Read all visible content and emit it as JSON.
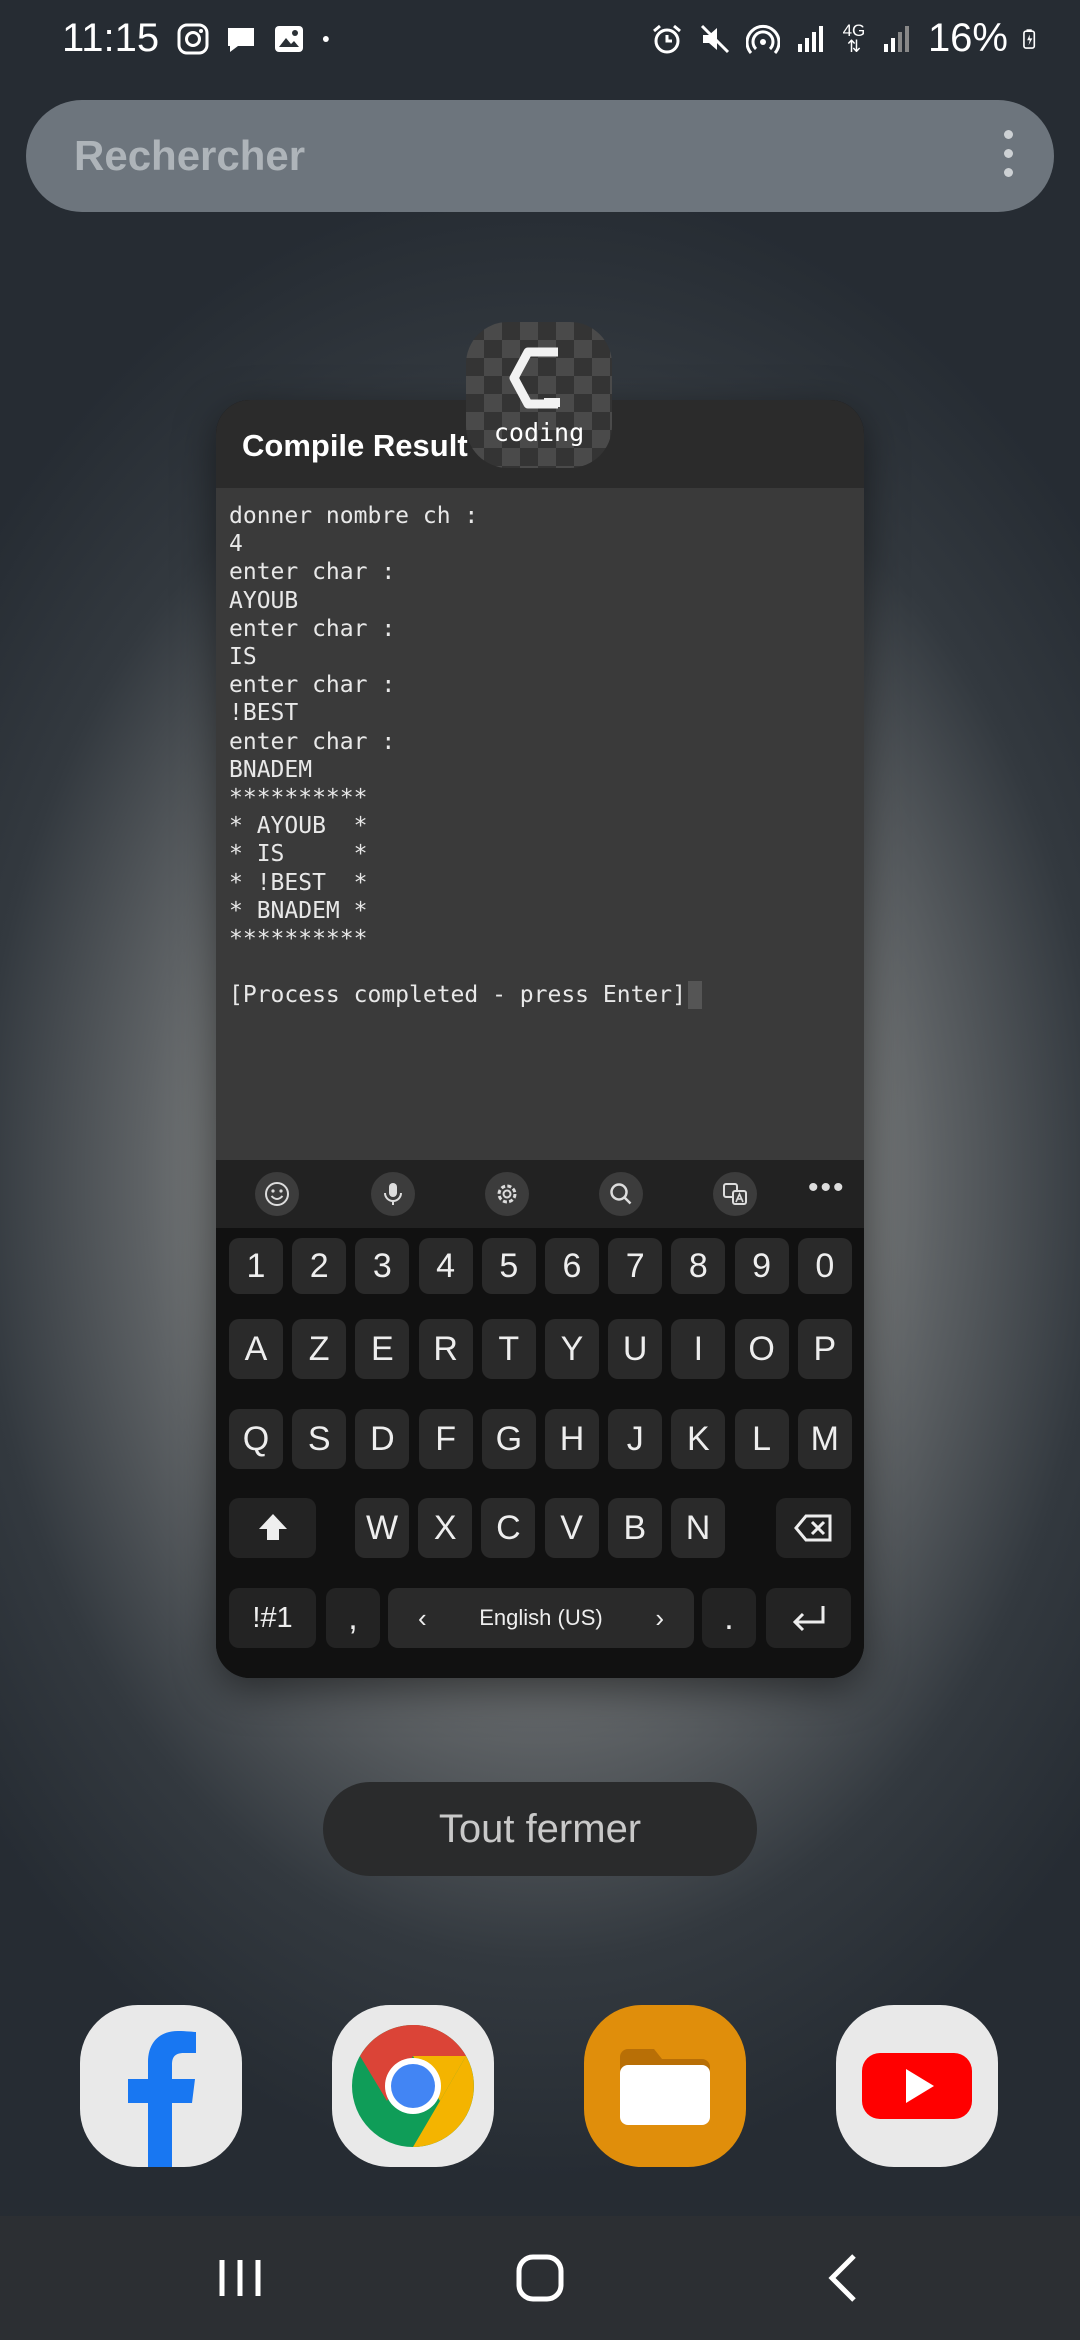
{
  "status_bar": {
    "time": "11:15",
    "battery": "16%",
    "icons_left": [
      "instagram-icon",
      "message-icon",
      "gallery-icon",
      "dot-icon"
    ],
    "icons_right": [
      "alarm-icon",
      "mute-icon",
      "hotspot-icon",
      "signal-icon",
      "4g-icon",
      "signal-icon",
      "battery-charging-icon"
    ],
    "network_label": "4G"
  },
  "search": {
    "placeholder": "Rechercher"
  },
  "app_card": {
    "title": "Compile Result",
    "app_icon_label": "coding",
    "terminal_lines": [
      "donner nombre ch :",
      "4",
      "enter char :",
      "AYOUB",
      "enter char :",
      "IS",
      "enter char :",
      "!BEST",
      "enter char :",
      "BNADEM",
      "**********",
      "* AYOUB  *",
      "* IS     *",
      "* !BEST  *",
      "* BNADEM *",
      "**********",
      "",
      "[Process completed - press Enter]"
    ]
  },
  "keyboard": {
    "toolbar": [
      "emoji-icon",
      "mic-icon",
      "settings-icon",
      "search-icon",
      "translate-icon",
      "more-icon"
    ],
    "number_row": [
      "1",
      "2",
      "3",
      "4",
      "5",
      "6",
      "7",
      "8",
      "9",
      "0"
    ],
    "row1": [
      "A",
      "Z",
      "E",
      "R",
      "T",
      "Y",
      "U",
      "I",
      "O",
      "P"
    ],
    "row2": [
      "Q",
      "S",
      "D",
      "F",
      "G",
      "H",
      "J",
      "K",
      "L",
      "M"
    ],
    "row3": [
      "W",
      "X",
      "C",
      "V",
      "B",
      "N"
    ],
    "symbols_label": "!#1",
    "comma_label": ",",
    "space_label": "English (US)",
    "period_label": "."
  },
  "close_all_label": "Tout fermer",
  "dock": [
    "facebook-icon",
    "chrome-icon",
    "files-icon",
    "youtube-icon"
  ],
  "nav": [
    "recents-button",
    "home-button",
    "back-button"
  ],
  "colors": {
    "facebook": "#1877F2",
    "files": "#E08E0B",
    "youtube": "#FF0000",
    "chrome_red": "#DB4437",
    "chrome_yellow": "#F4B400",
    "chrome_green": "#0F9D58",
    "chrome_blue": "#4285F4"
  }
}
